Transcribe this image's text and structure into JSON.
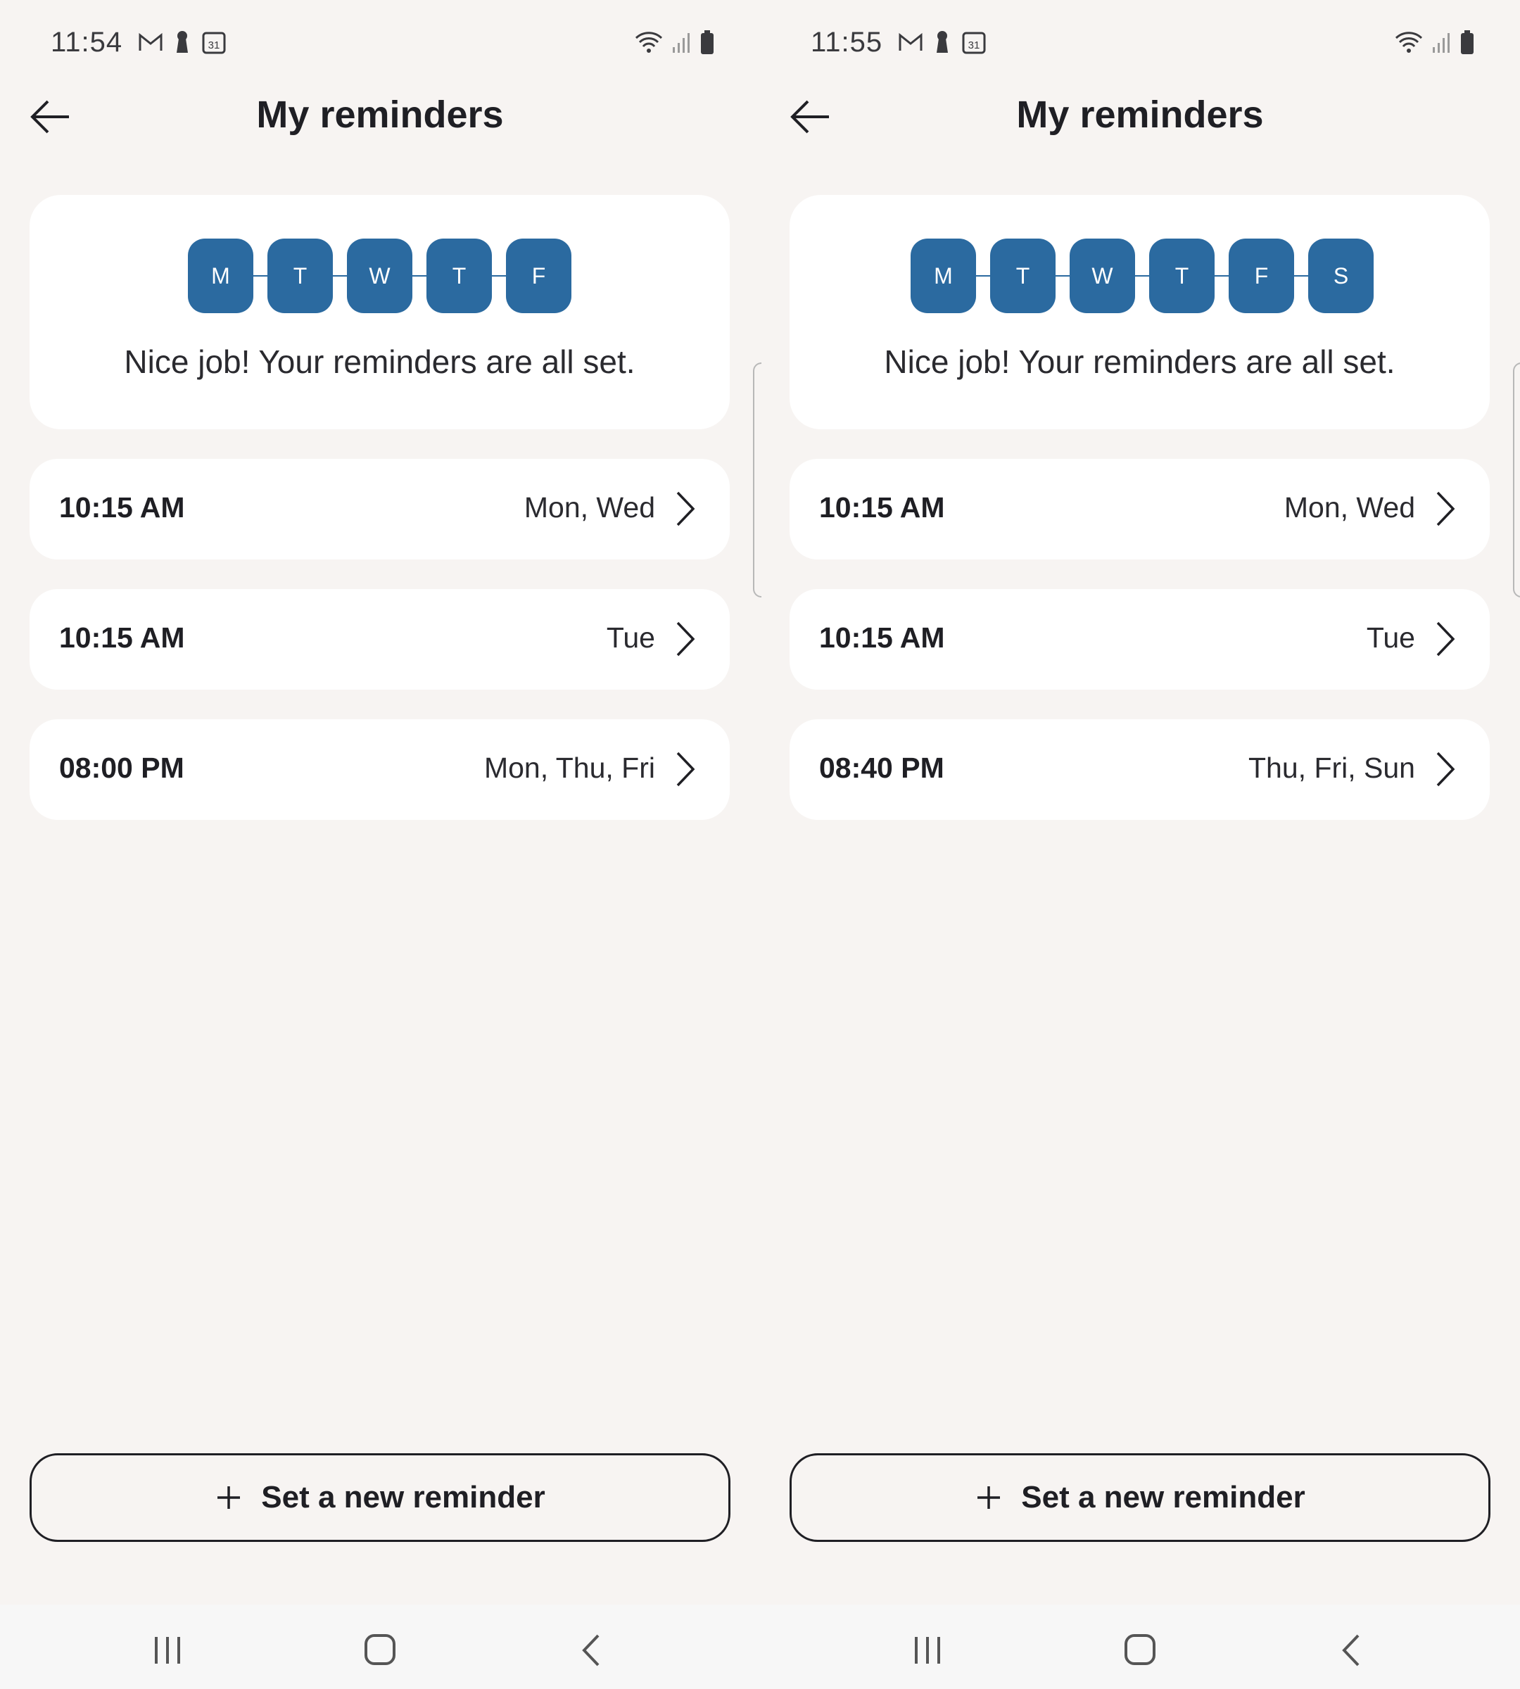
{
  "screens": [
    {
      "status": {
        "time": "11:54"
      },
      "header": {
        "title": "My reminders"
      },
      "summary": {
        "days": [
          "M",
          "T",
          "W",
          "T",
          "F"
        ],
        "message": "Nice job! Your reminders are all set."
      },
      "reminders": [
        {
          "time": "10:15 AM",
          "days": "Mon, Wed"
        },
        {
          "time": "10:15 AM",
          "days": "Tue"
        },
        {
          "time": "08:00 PM",
          "days": "Mon, Thu, Fri"
        }
      ],
      "new_button": {
        "label": "Set a new reminder"
      }
    },
    {
      "status": {
        "time": "11:55"
      },
      "header": {
        "title": "My reminders"
      },
      "summary": {
        "days": [
          "M",
          "T",
          "W",
          "T",
          "F",
          "S"
        ],
        "message": "Nice job! Your reminders are all set."
      },
      "reminders": [
        {
          "time": "10:15 AM",
          "days": "Mon, Wed"
        },
        {
          "time": "10:15 AM",
          "days": "Tue"
        },
        {
          "time": "08:40 PM",
          "days": "Thu, Fri, Sun"
        }
      ],
      "new_button": {
        "label": "Set a new reminder"
      }
    }
  ],
  "status_icons": [
    "gmail-icon",
    "keyhole-icon",
    "calendar-icon",
    "wifi-icon",
    "signal-icon",
    "battery-icon"
  ],
  "calendar_icon_text": "31",
  "colors": {
    "accent": "#2b6aa0",
    "background": "#f7f4f2",
    "card": "#ffffff",
    "text": "#1f1f24"
  }
}
